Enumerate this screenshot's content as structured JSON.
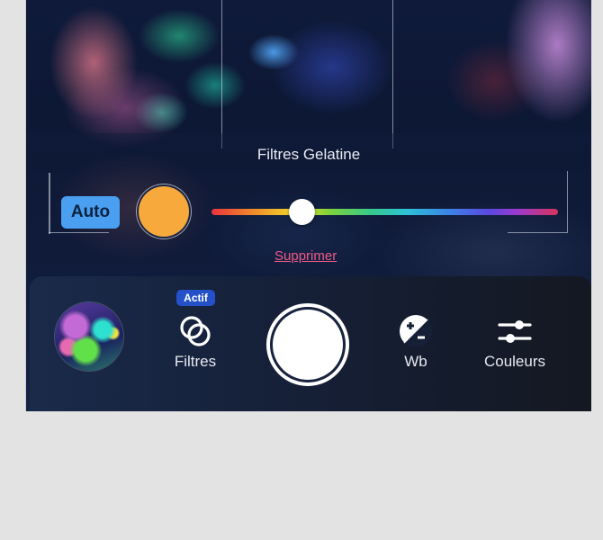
{
  "filter_panel": {
    "title": "Filtres Gelatine",
    "auto_label": "Auto",
    "selected_color": "#f7a93c",
    "hue_slider_value": 0.26,
    "delete_label": "Supprimer"
  },
  "toolbar": {
    "filters_badge": "Actif",
    "filters_label": "Filtres",
    "wb_label": "Wb",
    "colors_label": "Couleurs"
  },
  "colors": {
    "accent_blue": "#4a9ff0",
    "badge_blue": "#2450c8",
    "delete_pink": "#f05a86"
  }
}
